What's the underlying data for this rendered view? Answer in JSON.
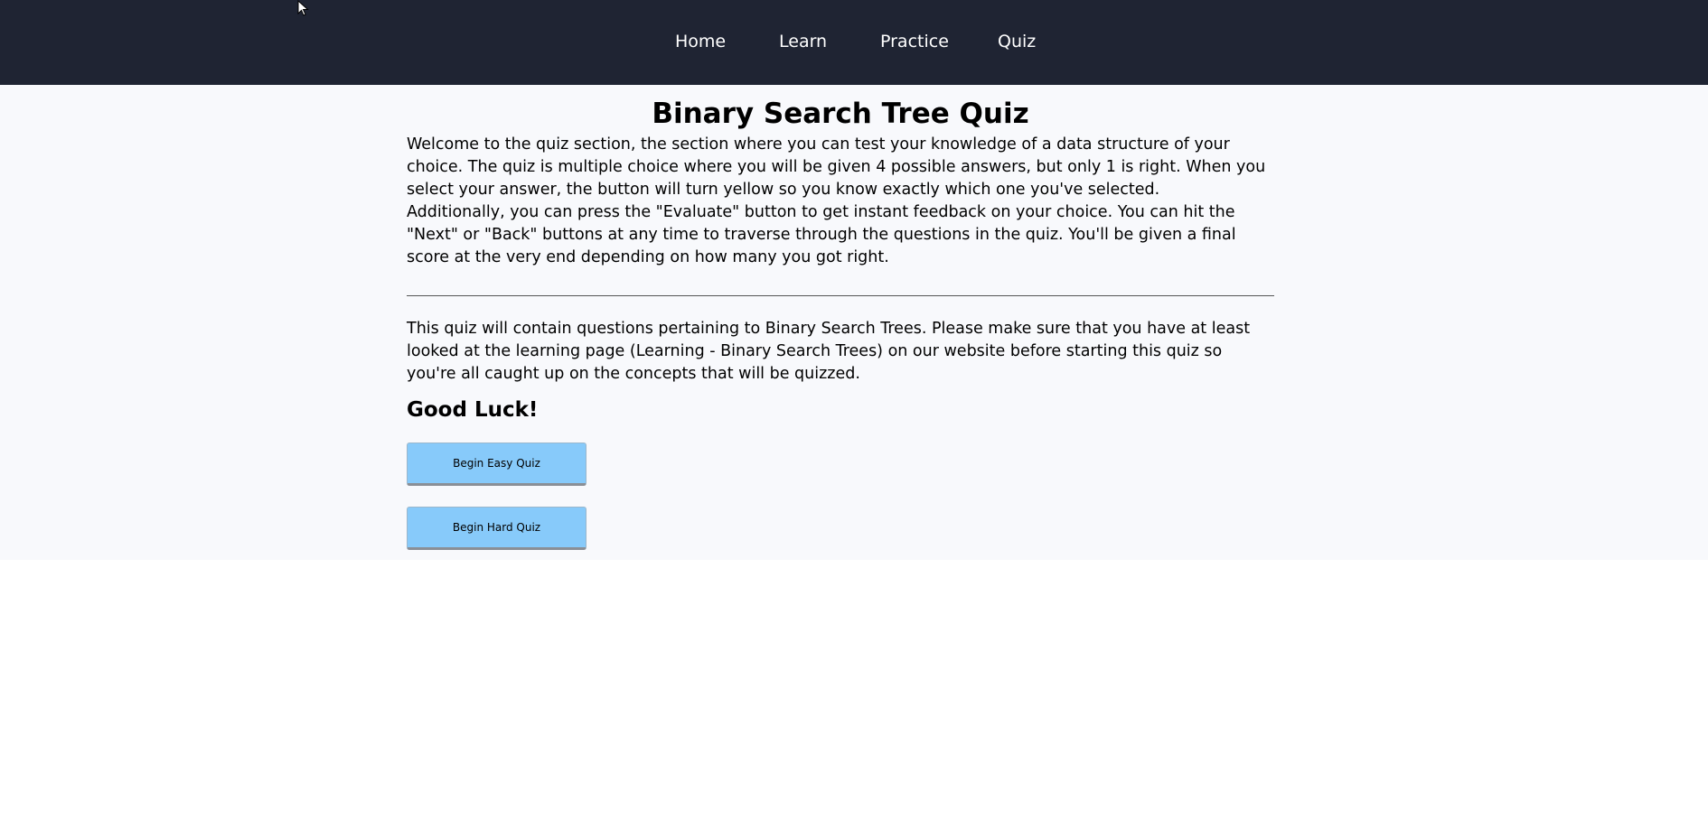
{
  "nav": {
    "items": [
      {
        "label": "Home"
      },
      {
        "label": "Learn"
      },
      {
        "label": "Practice"
      },
      {
        "label": "Quiz"
      }
    ]
  },
  "main": {
    "title": "Binary Search Tree Quiz",
    "intro_paragraph_1": "Welcome to the quiz section, the section where you can test your knowledge of a data structure of your choice. The quiz is multiple choice where you will be given 4 possible answers, but only 1 is right. When you select your answer, the button will turn yellow so you know exactly which one you've selected.",
    "intro_paragraph_2": "Additionally, you can press the \"Evaluate\" button to get instant feedback on your choice. You can hit the \"Next\" or \"Back\" buttons at any time to traverse through the questions in the quiz. You'll be given a final score at the very end depending on how many you got right.",
    "topic_paragraph": "This quiz will contain questions pertaining to Binary Search Trees. Please make sure that you have at least looked at the learning page (Learning - Binary Search Trees) on our website before starting this quiz so you're all caught up on the concepts that will be quizzed.",
    "good_luck": "Good Luck!",
    "buttons": {
      "easy": "Begin Easy Quiz",
      "hard": "Begin Hard Quiz"
    }
  },
  "colors": {
    "navbar_bg": "#1f2433",
    "page_bg": "#f8f9fc",
    "button_bg": "#87cafa"
  },
  "icons": {
    "cursor": "mouse-pointer-icon"
  }
}
